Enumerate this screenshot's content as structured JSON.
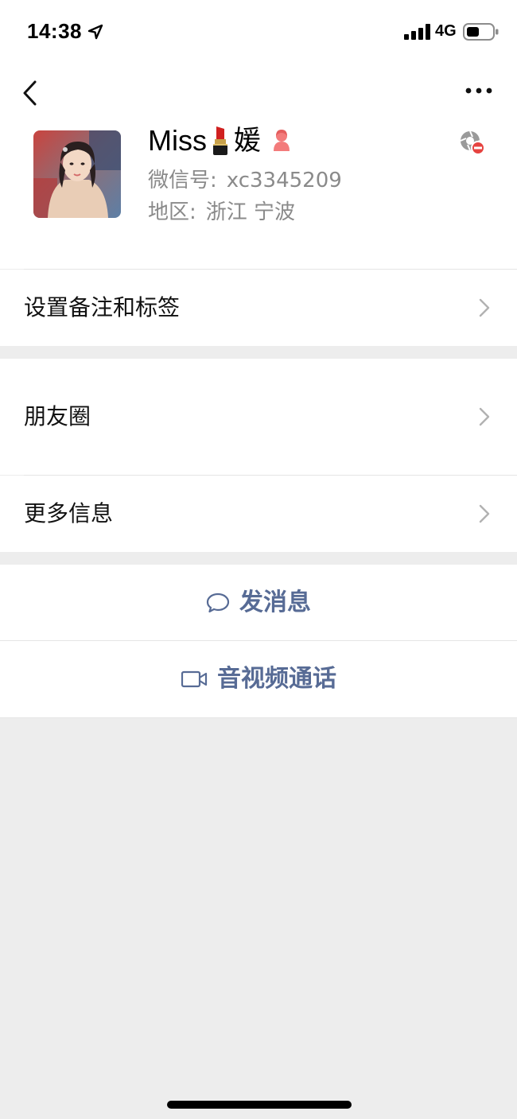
{
  "status_bar": {
    "time": "14:38",
    "network": "4G",
    "icons": [
      "location-arrow-icon",
      "signal-bars-icon",
      "battery-icon"
    ]
  },
  "nav": {
    "back_icon": "chevron-left-icon",
    "more_icon": "ellipsis-icon"
  },
  "profile": {
    "name": "Miss",
    "name_emoji_icon": "lipstick-icon",
    "name_suffix": "媛",
    "gender_icon": "female-icon",
    "status_icon": "blocked-moments-icon",
    "wechat_id_label": "微信号:",
    "wechat_id": "xc3345209",
    "region_label": "地区:",
    "region": "浙江 宁波"
  },
  "cells": {
    "remark": "设置备注和标签",
    "moments": "朋友圈",
    "more_info": "更多信息"
  },
  "actions": {
    "message": "发消息",
    "call": "音视频通话"
  },
  "colors": {
    "link": "#576b95",
    "background": "#ededed",
    "card": "#ffffff",
    "secondary_text": "#8a8a8a",
    "chevron": "#b2b2b2",
    "female_icon": "#f37b7b"
  }
}
